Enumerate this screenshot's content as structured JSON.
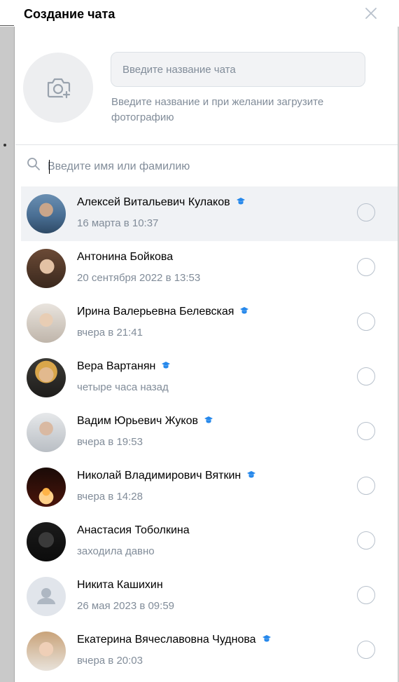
{
  "modal": {
    "title": "Создание чата",
    "chat_name_placeholder": "Введите название чата",
    "hint": "Введите название и при желании загрузите фотографию",
    "search_placeholder": "Введите имя или фамилию"
  },
  "contacts": [
    {
      "name": "Алексей Витальевич Кулаков",
      "status": "16 марта в 10:37",
      "verified": true,
      "active": true
    },
    {
      "name": "Антонина Бойкова",
      "status": "20 сентября 2022 в 13:53",
      "verified": false
    },
    {
      "name": "Ирина Валерьевна Белевская",
      "status": "вчера в 21:41",
      "verified": true
    },
    {
      "name": "Вера Вартанян",
      "status": "четыре часа назад",
      "verified": true
    },
    {
      "name": "Вадим Юрьевич Жуков",
      "status": "вчера в 19:53",
      "verified": true
    },
    {
      "name": "Николай Владимирович Вяткин",
      "status": "вчера в 14:28",
      "verified": true
    },
    {
      "name": "Анастасия Тоболкина",
      "status": "заходила давно",
      "verified": false
    },
    {
      "name": "Никита Кашихин",
      "status": "26 мая 2023 в 09:59",
      "verified": false
    },
    {
      "name": "Екатерина Вячеславовна Чуднова",
      "status": "вчера в 20:03",
      "verified": true
    }
  ],
  "colors": {
    "accent": "#2688eb",
    "secondary_text": "#818c99",
    "input_bg": "#f2f3f5",
    "row_hover": "#f0f2f5"
  }
}
